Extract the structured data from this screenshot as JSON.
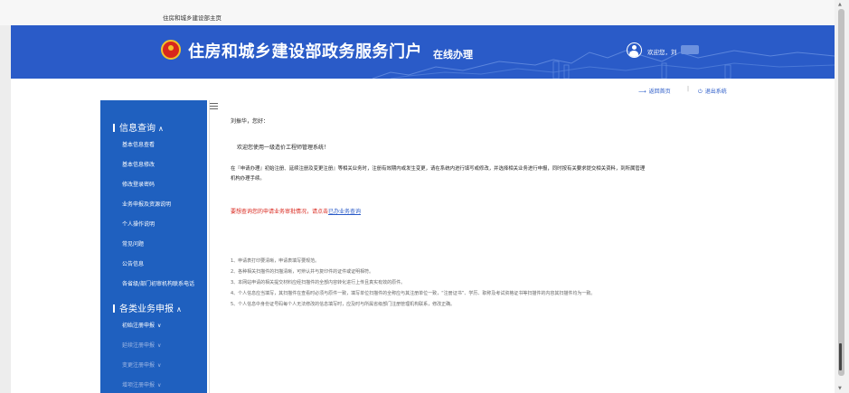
{
  "browser_tab": {
    "title": "住房和城乡建设部主页"
  },
  "header": {
    "site_title": "住房和城乡建设部政务服务门户",
    "subtitle": "在线办理",
    "welcome": "欢迎您，刘"
  },
  "toplinks": {
    "home": "返回首页",
    "separator": "|",
    "logout": "退出系统"
  },
  "sidebar": {
    "group1": "信息查询",
    "items1": [
      "基本信息查看",
      "基本信息修改",
      "修改登录密码",
      "业务申报及资源说明",
      "个人操作说明",
      "常见问题",
      "公告信息",
      "各省级/部门初审机构联系电话"
    ],
    "group2": "各类业务申报",
    "items2": [
      "初始注册申报",
      "延续注册申报",
      "变更注册申报",
      "增项注册申报"
    ]
  },
  "main": {
    "greeting": "刘振华，您好：",
    "welcome_msg": "欢迎您使用一级造价工程师管理系统！",
    "instruction_1": "在『申请办理』初始注册、延续注册及变更注册』等相关业务时，注册有效期内或发生变更，请在系统内进行填写或修改，并选择相关业务进行申报，同时按有关要求提交相关资料，到所属管理",
    "instruction_2": "机构办理手续。",
    "query_text": "要想查询您的申请业务审批情况，请点击",
    "query_link": "已办业务查询",
    "notes": [
      "1、申请表打印要清晰，申请表填写要规范。",
      "2、各种相关扫描件的扫描清晰，可辨认并与复印件的证件或证明相符。",
      "3、本网站申请的相关提交材料应经扫描件的全部内容转化进行上传且真实有效的原件。",
      "4、个人信息应当填写，其扫描件在查看时必须与原件一致，填写单位扫描件的全称应与其注册单位一致，“注册证书”、学历、职称及考试资格证书等扫描件的内容其扫描件均为一致。",
      "5、个人信息中身份证号码每个人无法修改的信息填写时，应及时与所属省级部门注册管理机构联系，修改正确。"
    ]
  },
  "colors": {
    "brand_blue": "#2a5bc8",
    "sidebar_blue": "#1f60bf",
    "alert_red": "#d9261c"
  }
}
